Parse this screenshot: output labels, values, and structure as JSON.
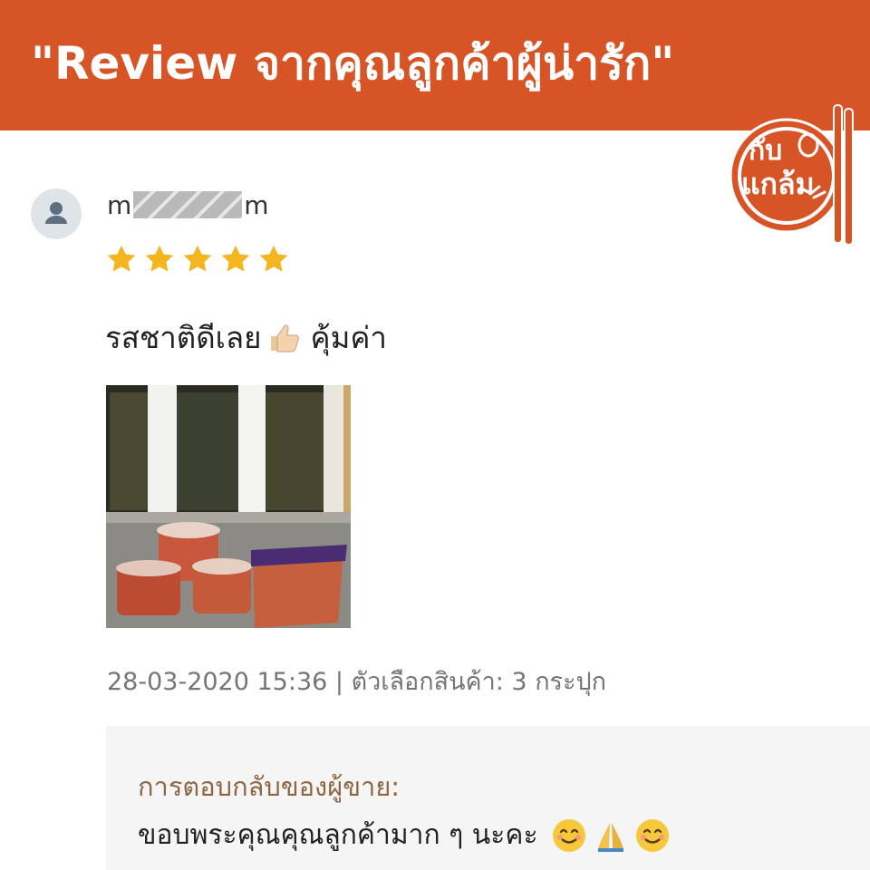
{
  "banner": {
    "title": "\"Review จากคุณลูกค้าผู้น่ารัก\""
  },
  "logo": {
    "line1": "กับ",
    "line2": "แกล้ม",
    "color": "#d65425"
  },
  "review": {
    "username_prefix": "m",
    "username_suffix": "m",
    "rating": 5,
    "text": "รสชาติดีเลย",
    "text_after_emoji": "คุ้มค่า",
    "meta": "28-03-2020 15:36 | ตัวเลือกสินค้า: 3 กระปุก"
  },
  "seller_reply": {
    "label": "การตอบกลับของผู้ขาย:",
    "text": "ขอบพระคุณคุณลูกค้ามาก ๆ นะคะ"
  },
  "colors": {
    "banner": "#d65425",
    "star": "#f5b51f",
    "reply_label": "#8e6642"
  }
}
